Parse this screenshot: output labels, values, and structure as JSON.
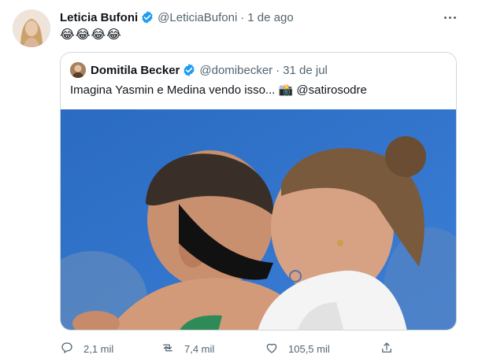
{
  "tweet": {
    "author_name": "Leticia Bufoni",
    "author_handle": "@LeticiaBufoni",
    "separator": "·",
    "time": "1 de ago",
    "text": "😂😂😂😂",
    "verified": true
  },
  "quote": {
    "author_name": "Domitila Becker",
    "author_handle": "@domibecker",
    "separator": "·",
    "time": "31 de jul",
    "text": "Imagina Yasmin e Medina vendo isso... 📸 @satirosodre",
    "verified": true
  },
  "actions": {
    "reply_count": "2,1 mil",
    "retweet_count": "7,4 mil",
    "like_count": "105,5 mil"
  },
  "icons": {
    "reply": "speech-bubble-icon",
    "retweet": "retweet-icon",
    "like": "heart-icon",
    "share": "share-icon",
    "more": "more-dots-icon",
    "verified": "verified-badge-icon"
  },
  "colors": {
    "verified": "#1d9bf0",
    "secondary_text": "#536471",
    "border": "#cfd9de",
    "photo_background": "#2f6fc4"
  }
}
